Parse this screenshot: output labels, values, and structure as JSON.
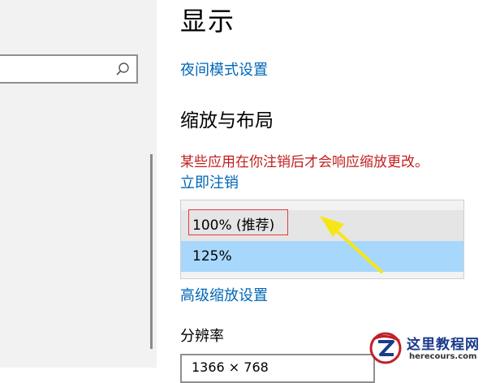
{
  "page": {
    "title": "显示"
  },
  "links": {
    "night_mode": "夜间模式设置",
    "sign_out": "立即注销",
    "advanced_scaling": "高级缩放设置"
  },
  "scale_section": {
    "title": "缩放与布局",
    "warning": "某些应用在你注销后才会响应缩放更改。",
    "options": [
      {
        "label": "100% (推荐)",
        "state": "hover"
      },
      {
        "label": "125%",
        "state": "selected"
      }
    ]
  },
  "resolution": {
    "label": "分辨率",
    "value": "1366 × 768"
  },
  "watermark": {
    "title": "这里教程网",
    "url": "herecours.com"
  },
  "colors": {
    "link": "#0067b8",
    "warning": "#c41e1e",
    "selected": "#a8d7fc",
    "annotation_box": "#e23b3b",
    "annotation_arrow": "#f5e61a"
  },
  "icons": {
    "search": "search-icon"
  }
}
